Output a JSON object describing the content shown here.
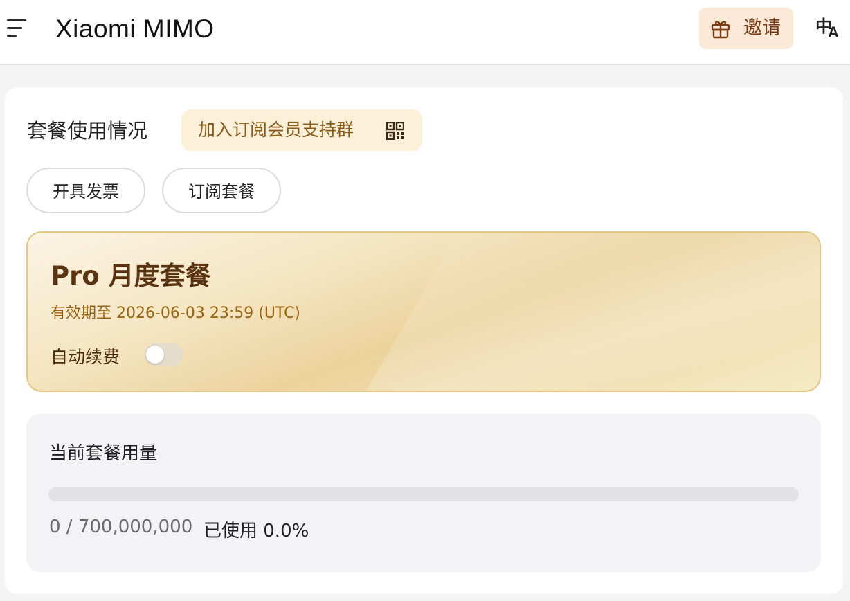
{
  "header": {
    "logo_text": "Xiaomi MIMO",
    "invite_label": "邀请",
    "language_icon": "language-switch-icon"
  },
  "subscription": {
    "section_title": "套餐使用情况",
    "support_group_label": "加入订阅会员支持群",
    "support_group_icon": "qr-code-icon",
    "invoice_button": "开具发票",
    "subscribe_button": "订阅套餐"
  },
  "plan": {
    "name": "Pro 月度套餐",
    "expiry": "有效期至 2026-06-03 23:59 (UTC)",
    "auto_renew_label": "自动续费",
    "auto_renew_enabled": false
  },
  "usage": {
    "title": "当前套餐用量",
    "count_text": "0 / 700,000,000",
    "percent_text": "已使用 0.0%",
    "used_fraction": 0.0
  },
  "colors": {
    "invite_bg": "#fbe8d6",
    "gold_accent": "#e2c785",
    "support_bg": "#fdf0d9"
  }
}
